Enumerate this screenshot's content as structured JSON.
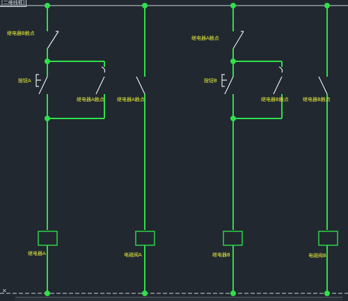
{
  "viewport": {
    "label": "[二维线框]"
  },
  "labels": {
    "relay_b_contact_left": "继电器B触点",
    "button_a": "按钮A",
    "relay_a_contact_left": "继电器A触点",
    "relay_a_contact_valve": "继电器A触点",
    "relay_a_coil": "继电器A",
    "valve_a": "电磁阀A",
    "relay_a_contact_right": "继电器A触点",
    "button_b": "按钮B",
    "relay_b_contact_right": "继电器B触点",
    "relay_b_contact_valve": "继电器B触点",
    "relay_b_coil": "继电器B",
    "valve_b": "电磁阀B"
  },
  "colors": {
    "background": "#212830",
    "wire": "#2fe04a",
    "contact": "#e6ebef",
    "label": "#e8ec3a"
  }
}
